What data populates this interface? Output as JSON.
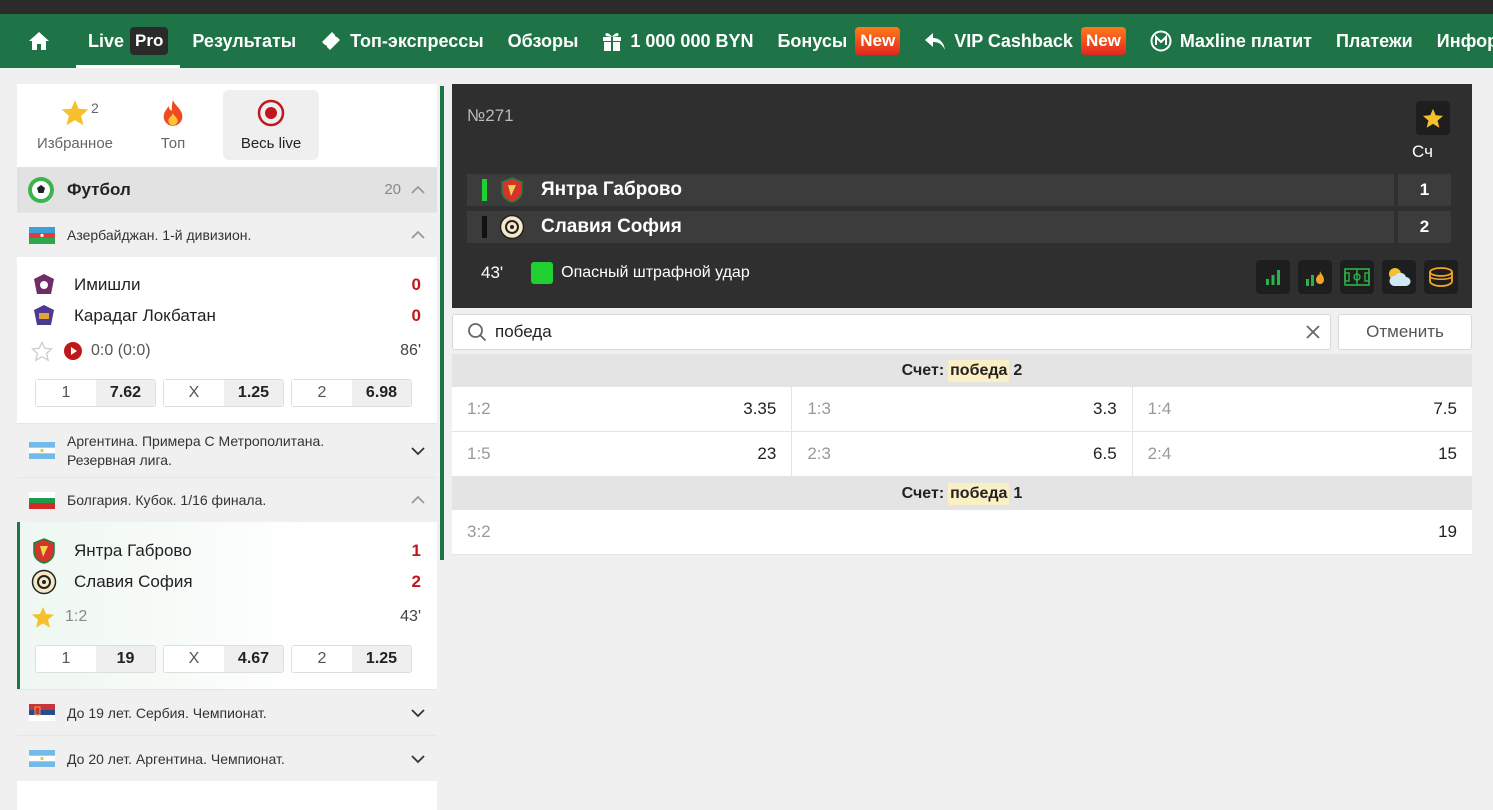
{
  "nav": {
    "live": "Live",
    "pro": "Pro",
    "results": "Результаты",
    "top_express": "Топ-экспрессы",
    "reviews": "Обзоры",
    "prize": "1 000 000 BYN",
    "bonuses": "Бонусы",
    "new1": "New",
    "vip": "VIP Cashback",
    "new2": "New",
    "maxline": "Maxline платит",
    "payments": "Платежи",
    "info": "Информация"
  },
  "tabs": {
    "favorites": "Избранное",
    "favorites_count": "2",
    "top": "Топ",
    "all_live": "Весь live"
  },
  "sport": {
    "name": "Футбол",
    "count": "20"
  },
  "leagues": [
    {
      "name": "Азербайджан. 1-й дивизион."
    },
    {
      "name": "Аргентина. Примера С Метрополитана. Резервная лига."
    },
    {
      "name": "Болгария. Кубок. 1/16 финала."
    },
    {
      "name": "До 19 лет. Сербия. Чемпионат."
    },
    {
      "name": "До 20 лет. Аргентина. Чемпионат."
    }
  ],
  "match1": {
    "home": "Имишли",
    "home_score": "0",
    "away": "Карадаг Локбатан",
    "away_score": "0",
    "status": "0:0 (0:0)",
    "minute": "86'",
    "odds": [
      {
        "k": "1",
        "v": "7.62"
      },
      {
        "k": "X",
        "v": "1.25"
      },
      {
        "k": "2",
        "v": "6.98"
      }
    ]
  },
  "match2": {
    "home": "Янтра Габрово",
    "home_score": "1",
    "away": "Славия София",
    "away_score": "2",
    "status": "1:2",
    "minute": "43'",
    "odds": [
      {
        "k": "1",
        "v": "19"
      },
      {
        "k": "X",
        "v": "4.67"
      },
      {
        "k": "2",
        "v": "1.25"
      }
    ]
  },
  "scoreboard": {
    "number": "№271",
    "score_header": "Сч",
    "home": "Янтра Габрово",
    "home_score": "1",
    "away": "Славия София",
    "away_score": "2",
    "minute": "43'",
    "event": "Опасный штрафной удар"
  },
  "search": {
    "value": "победа",
    "cancel": "Отменить"
  },
  "markets": [
    {
      "prefix": "Счет:",
      "highlight": "победа",
      "suffix": "2",
      "rows": [
        [
          {
            "k": "1:2",
            "v": "3.35"
          },
          {
            "k": "1:3",
            "v": "3.3"
          },
          {
            "k": "1:4",
            "v": "7.5"
          }
        ],
        [
          {
            "k": "1:5",
            "v": "23"
          },
          {
            "k": "2:3",
            "v": "6.5"
          },
          {
            "k": "2:4",
            "v": "15"
          }
        ]
      ]
    },
    {
      "prefix": "Счет:",
      "highlight": "победа",
      "suffix": "1",
      "rows": [
        [
          {
            "k": "3:2",
            "v": "19"
          }
        ]
      ]
    }
  ],
  "colors": {
    "brand_green": "#1e7446",
    "new_badge": "#e3261e",
    "score_red": "#c0171d",
    "event_green": "#1fd130"
  }
}
